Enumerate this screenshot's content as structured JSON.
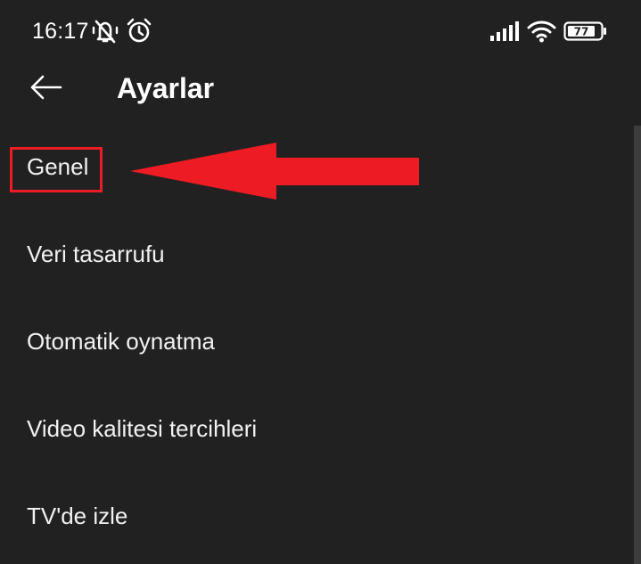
{
  "status_bar": {
    "time": "16:17",
    "battery_level": "77",
    "icons": [
      "muted-bell-icon",
      "alarm-icon",
      "signal-icon",
      "wifi-icon",
      "battery-icon"
    ]
  },
  "app_bar": {
    "back_icon": "arrow-left-icon",
    "title": "Ayarlar"
  },
  "settings": {
    "items": [
      {
        "label": "Genel"
      },
      {
        "label": "Veri tasarrufu"
      },
      {
        "label": "Otomatik oynatma"
      },
      {
        "label": "Video kalitesi tercihleri"
      },
      {
        "label": "TV'de izle"
      }
    ]
  },
  "annotation": {
    "highlighted_item": "Genel",
    "color": "#ed1c24"
  },
  "colors": {
    "background": "#212121",
    "text": "#ffffff",
    "scrollbar": "#3d3d3d"
  }
}
